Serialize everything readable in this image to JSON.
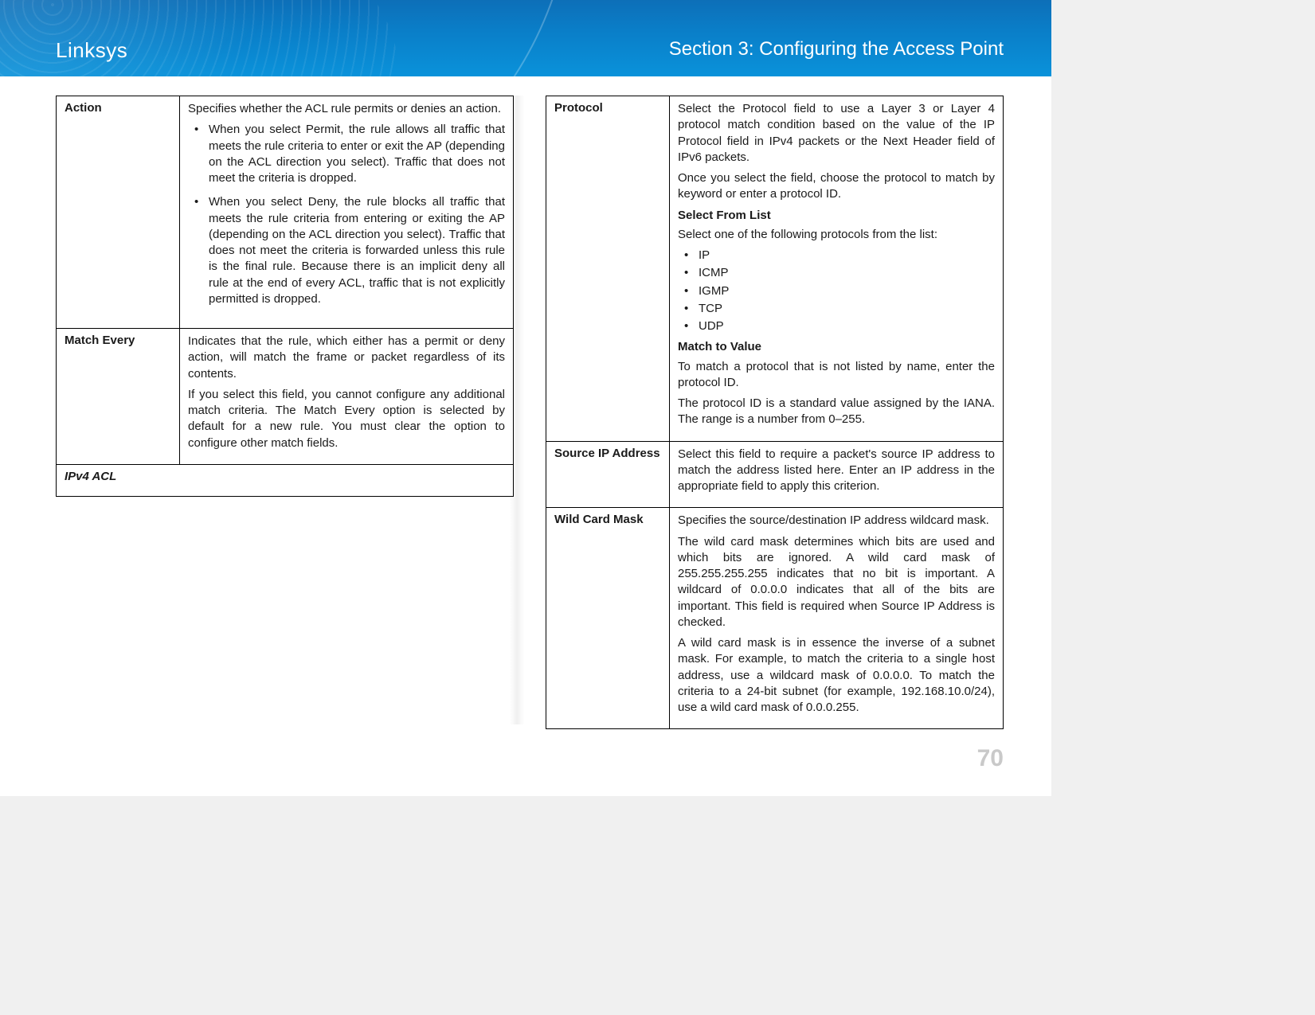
{
  "header": {
    "brand": "Linksys",
    "section_title": "Section 3:  Configuring the Access Point"
  },
  "left_table": {
    "rows": [
      {
        "term": "Action",
        "body": {
          "intro": "Specifies whether the ACL rule permits or denies an action.",
          "bullets": [
            "When you select Permit, the rule allows all traffic that meets the rule criteria to enter or exit the AP (depending on the ACL direction you select). Traffic that does not meet the criteria is dropped.",
            "When you select Deny, the rule blocks all traffic that meets the rule criteria from entering or exiting the AP (depending on the ACL direction you select). Traffic that does not meet the criteria is forwarded unless this rule is the final rule. Because there is an implicit deny all rule at the end of every ACL, traffic that is not explicitly permitted is dropped."
          ]
        }
      },
      {
        "term": "Match Every",
        "body": {
          "p1": "Indicates that the rule, which either has a permit or deny action, will match the frame or packet regardless of its contents.",
          "p2": "If you select this field, you cannot configure any additional match criteria. The Match Every option is selected by default for a new rule. You must clear the option to configure other match fields."
        }
      }
    ],
    "section_row": "IPv4 ACL"
  },
  "right_table": {
    "rows": [
      {
        "term": "Protocol",
        "body": {
          "p1": "Select the Protocol field to use a Layer 3 or Layer 4 protocol match condition based on the value of the IP Protocol field in IPv4 packets or the Next Header field of IPv6 packets.",
          "p2": "Once you select the field, choose the protocol to match by keyword or enter a protocol ID.",
          "sub1_head": "Select From List",
          "sub1_text": "Select one of the following protocols from the list:",
          "sub1_items": [
            "IP",
            "ICMP",
            "IGMP",
            "TCP",
            "UDP"
          ],
          "sub2_head": "Match to Value",
          "sub2_p1": "To match a protocol that is not listed by name, enter the protocol ID.",
          "sub2_p2": "The protocol ID is a standard value assigned by the IANA. The range is a number from 0–255."
        }
      },
      {
        "term": "Source IP Address",
        "body": {
          "p1": "Select this field to require a packet's source IP address to match the address listed here. Enter an IP address in the appropriate field to apply this criterion."
        }
      },
      {
        "term": "Wild Card Mask",
        "body": {
          "p1": "Specifies the source/destination IP address wildcard mask.",
          "p2": "The wild card mask determines which bits are used and which bits are ignored. A wild card mask of 255.255.255.255 indicates that no bit is important. A wildcard of 0.0.0.0 indicates that all of the bits are important. This field is required when Source IP Address is checked.",
          "p3": "A wild card mask is in essence the inverse of a subnet mask. For example, to match the criteria to a single host address, use a wildcard mask of 0.0.0.0. To match the criteria to a 24-bit subnet (for example, 192.168.10.0/24), use a wild card mask of 0.0.0.255."
        }
      }
    ]
  },
  "page_number": "70"
}
